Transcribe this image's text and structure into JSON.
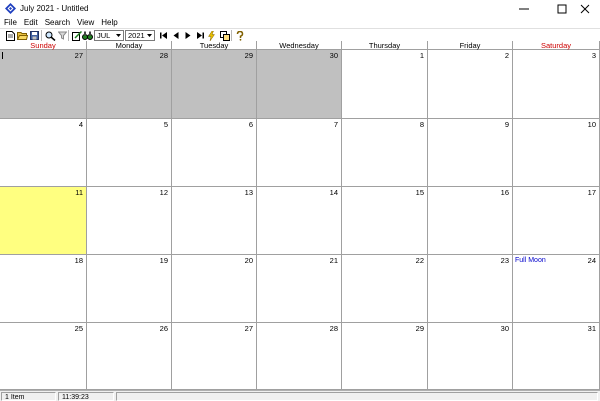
{
  "window": {
    "title": "July 2021 - Untitled",
    "icon": "app-diamond-icon",
    "controls": [
      "minimize-icon",
      "maximize-icon",
      "close-icon"
    ]
  },
  "menu": [
    "File",
    "Edit",
    "Search",
    "View",
    "Help"
  ],
  "toolbar": {
    "month": "JUL",
    "year": "2021",
    "icons": [
      "new-file-icon",
      "open-folder-icon",
      "save-icon",
      "find-icon",
      "filter-icon",
      "edit-note-icon",
      "binoculars-icon",
      "first-icon",
      "prev-icon",
      "next-icon",
      "last-icon",
      "lightning-icon",
      "copy-icon",
      "help-icon"
    ]
  },
  "calendar": {
    "day_headers": [
      {
        "label": "Sunday",
        "color": "#cc0000"
      },
      {
        "label": "Monday",
        "color": "#000000"
      },
      {
        "label": "Tuesday",
        "color": "#000000"
      },
      {
        "label": "Wednesday",
        "color": "#000000"
      },
      {
        "label": "Thursday",
        "color": "#000000"
      },
      {
        "label": "Friday",
        "color": "#000000"
      },
      {
        "label": "Saturday",
        "color": "#cc0000"
      }
    ],
    "weeks": [
      [
        {
          "day": "27",
          "state": "other"
        },
        {
          "day": "28",
          "state": "other"
        },
        {
          "day": "29",
          "state": "other"
        },
        {
          "day": "30",
          "state": "other"
        },
        {
          "day": "1"
        },
        {
          "day": "2"
        },
        {
          "day": "3"
        }
      ],
      [
        {
          "day": "4"
        },
        {
          "day": "5"
        },
        {
          "day": "6"
        },
        {
          "day": "7"
        },
        {
          "day": "8"
        },
        {
          "day": "9"
        },
        {
          "day": "10"
        }
      ],
      [
        {
          "day": "11",
          "state": "today"
        },
        {
          "day": "12"
        },
        {
          "day": "13"
        },
        {
          "day": "14"
        },
        {
          "day": "15"
        },
        {
          "day": "16"
        },
        {
          "day": "17"
        }
      ],
      [
        {
          "day": "18"
        },
        {
          "day": "19"
        },
        {
          "day": "20"
        },
        {
          "day": "21"
        },
        {
          "day": "22"
        },
        {
          "day": "23"
        },
        {
          "day": "24",
          "event": "Full Moon"
        }
      ],
      [
        {
          "day": "25"
        },
        {
          "day": "26"
        },
        {
          "day": "27"
        },
        {
          "day": "28"
        },
        {
          "day": "29"
        },
        {
          "day": "30"
        },
        {
          "day": "31"
        }
      ]
    ],
    "colors": {
      "other_month": "#c0c0c0",
      "today": "#ffff80",
      "event": "#0000cc",
      "weekend_header": "#cc0000"
    }
  },
  "status": {
    "items": "1 Item",
    "time": "11:39:23"
  }
}
